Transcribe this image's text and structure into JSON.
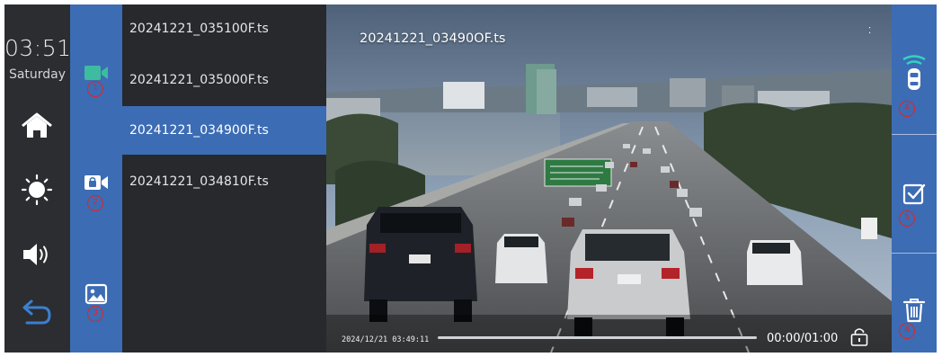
{
  "status": {
    "clock": "03:51",
    "weekday": "Saturday"
  },
  "nav": {
    "icons": [
      "home-icon",
      "brightness-icon",
      "volume-icon",
      "back-icon"
    ]
  },
  "categories": {
    "icons": [
      "video-camera-icon",
      "locked-video-icon",
      "photo-icon"
    ],
    "active_color": "#3dbca0",
    "markers": [
      "1",
      "2",
      "3"
    ]
  },
  "files": [
    {
      "name": "20241221_035100F.ts",
      "selected": false
    },
    {
      "name": "20241221_035000F.ts",
      "selected": false
    },
    {
      "name": "20241221_034900F.ts",
      "selected": true
    },
    {
      "name": "20241221_034810F.ts",
      "selected": false
    }
  ],
  "player": {
    "title": "20241221_03490OF.ts",
    "overlay_dots": "⁚",
    "timestamp": "2024/12/21  03:49:11",
    "duration": "00:00/01:00",
    "progress": 0
  },
  "actions": {
    "icons": [
      "car-sensor-icon",
      "select-checkbox-icon",
      "trash-icon"
    ],
    "markers": [
      "4",
      "5",
      "6"
    ]
  },
  "colors": {
    "accent_blue": "#3c6cb4",
    "annotation_red": "#e0242a",
    "panel_dark": "#27292d"
  }
}
